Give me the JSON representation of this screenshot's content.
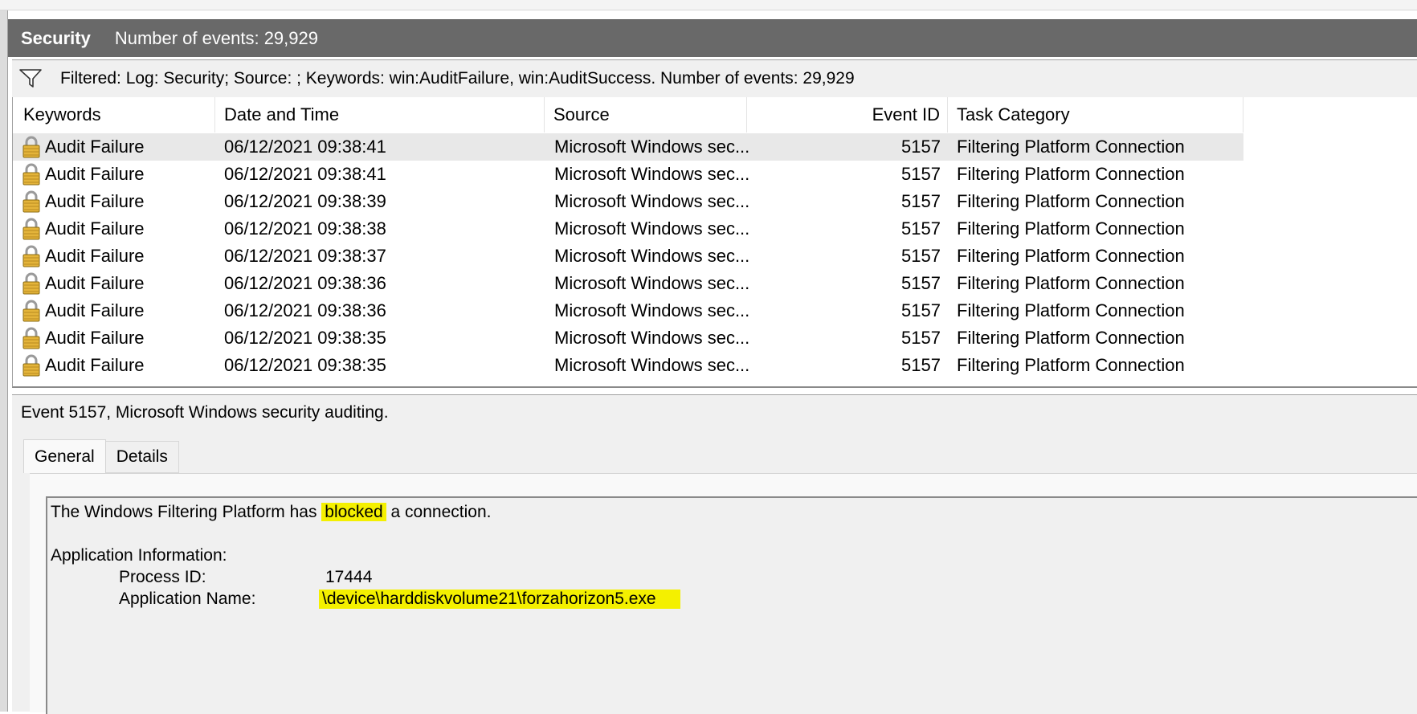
{
  "window": {
    "log_name": "Security",
    "event_count_label": "Number of events: 29,929"
  },
  "filter": {
    "icon": "funnel-icon",
    "text": "Filtered: Log: Security; Source: ; Keywords: win:AuditFailure, win:AuditSuccess. Number of events: 29,929"
  },
  "columns": [
    "Keywords",
    "Date and Time",
    "Source",
    "Event ID",
    "Task Category"
  ],
  "rows": [
    {
      "keywords": "Audit Failure",
      "datetime": "06/12/2021 09:38:41",
      "source": "Microsoft Windows sec...",
      "event_id": "5157",
      "task_category": "Filtering Platform Connection",
      "icon": "lock-icon",
      "selected": true
    },
    {
      "keywords": "Audit Failure",
      "datetime": "06/12/2021 09:38:41",
      "source": "Microsoft Windows sec...",
      "event_id": "5157",
      "task_category": "Filtering Platform Connection",
      "icon": "lock-icon"
    },
    {
      "keywords": "Audit Failure",
      "datetime": "06/12/2021 09:38:39",
      "source": "Microsoft Windows sec...",
      "event_id": "5157",
      "task_category": "Filtering Platform Connection",
      "icon": "lock-icon"
    },
    {
      "keywords": "Audit Failure",
      "datetime": "06/12/2021 09:38:38",
      "source": "Microsoft Windows sec...",
      "event_id": "5157",
      "task_category": "Filtering Platform Connection",
      "icon": "lock-icon"
    },
    {
      "keywords": "Audit Failure",
      "datetime": "06/12/2021 09:38:37",
      "source": "Microsoft Windows sec...",
      "event_id": "5157",
      "task_category": "Filtering Platform Connection",
      "icon": "lock-icon"
    },
    {
      "keywords": "Audit Failure",
      "datetime": "06/12/2021 09:38:36",
      "source": "Microsoft Windows sec...",
      "event_id": "5157",
      "task_category": "Filtering Platform Connection",
      "icon": "lock-icon"
    },
    {
      "keywords": "Audit Failure",
      "datetime": "06/12/2021 09:38:36",
      "source": "Microsoft Windows sec...",
      "event_id": "5157",
      "task_category": "Filtering Platform Connection",
      "icon": "lock-icon"
    },
    {
      "keywords": "Audit Failure",
      "datetime": "06/12/2021 09:38:35",
      "source": "Microsoft Windows sec...",
      "event_id": "5157",
      "task_category": "Filtering Platform Connection",
      "icon": "lock-icon"
    },
    {
      "keywords": "Audit Failure",
      "datetime": "06/12/2021 09:38:35",
      "source": "Microsoft Windows sec...",
      "event_id": "5157",
      "task_category": "Filtering Platform Connection",
      "icon": "lock-icon"
    }
  ],
  "detail": {
    "header": "Event 5157, Microsoft Windows security auditing.",
    "tabs": {
      "general": "General",
      "details": "Details"
    },
    "message": {
      "line1_before": "The Windows Filtering Platform has",
      "line1_highlight": "blocked",
      "line1_after": "a connection.",
      "section_title": "Application Information:",
      "process_id_label": "Process ID:",
      "process_id_value": "17444",
      "app_name_label": "Application Name:",
      "app_name_value": "\\device\\harddiskvolume21\\forzahorizon5.exe"
    },
    "highlight_color": "#f4f000"
  },
  "colors": {
    "title_bar": "#696969",
    "selected_row": "#e8e8e8",
    "lock_gold": "#e4b43a"
  }
}
